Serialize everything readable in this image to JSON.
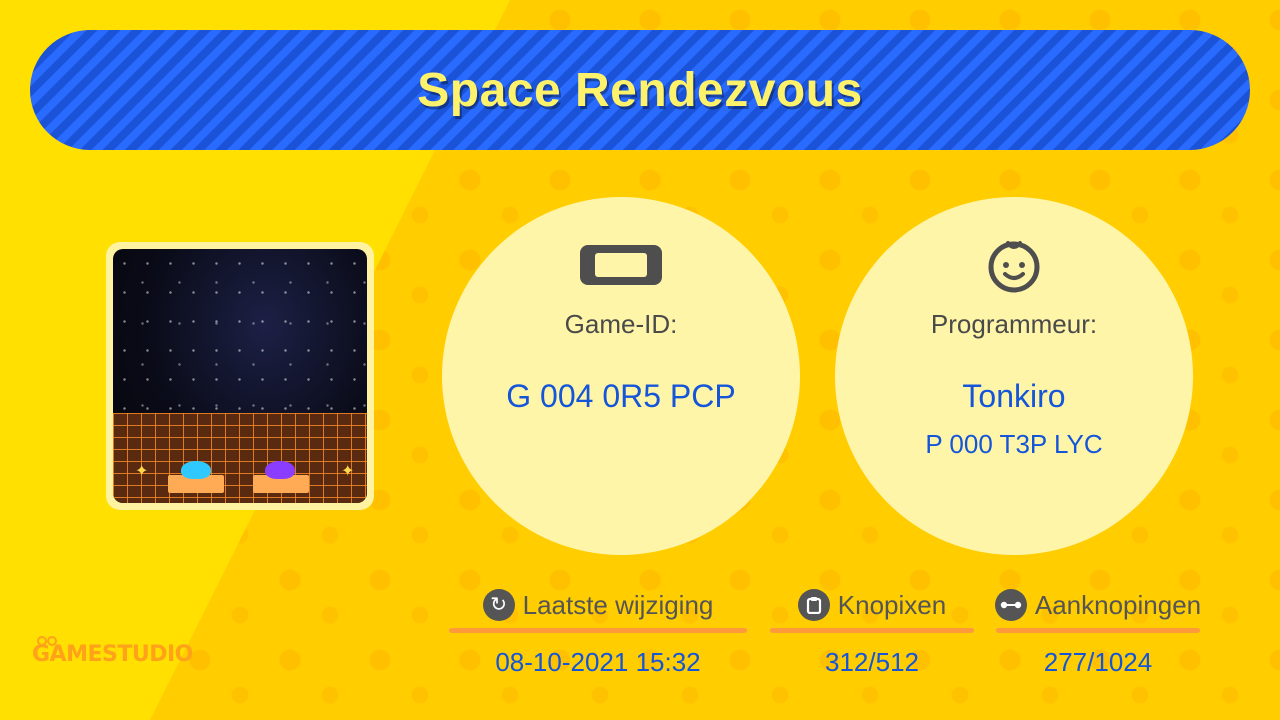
{
  "title": "Space Rendezvous",
  "colors": {
    "background": "#ffe000",
    "title_bar": "#1e5ef0",
    "title_text": "#fff26b",
    "value_text": "#1455d9",
    "accent_line": "#ff9a3c"
  },
  "thumbnail": {
    "icon": "game-thumbnail-image"
  },
  "game_id": {
    "icon": "game-console-icon",
    "label": "Game-ID:",
    "value": "G 004 0R5 PCP"
  },
  "programmer": {
    "icon": "face-icon",
    "label": "Programmeur:",
    "name": "Tonkiro",
    "id": "P 000 T3P LYC"
  },
  "stats": {
    "last_modified": {
      "icon": "refresh-icon",
      "label": "Laatste wijziging",
      "value": "08-10-2021 15:32"
    },
    "nodons": {
      "icon": "clipboard-icon",
      "label": "Knopixen",
      "value": "312/512"
    },
    "connections": {
      "icon": "link-icon",
      "label": "Aanknopingen",
      "value": "277/1024"
    }
  },
  "logo": {
    "text": "GAMESTUDIO"
  }
}
